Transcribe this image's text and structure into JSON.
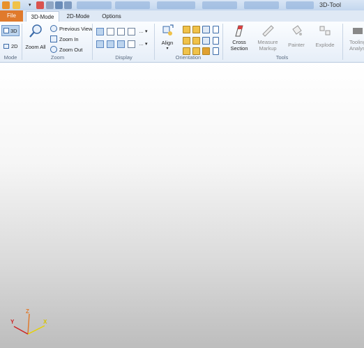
{
  "window": {
    "title": "3D-Tool"
  },
  "tabs": [
    {
      "label": "File"
    },
    {
      "label": "3D-Mode"
    },
    {
      "label": "2D-Mode"
    },
    {
      "label": "Options"
    }
  ],
  "ribbon": {
    "mode": {
      "label": "Mode",
      "btn3d": "3D",
      "btn2d": "2D"
    },
    "zoom": {
      "label": "Zoom",
      "zoom_all": "Zoom All",
      "previous_view": "Previous View",
      "zoom_in": "Zoom In",
      "zoom_out": "Zoom Out"
    },
    "display": {
      "label": "Display"
    },
    "orientation": {
      "label": "Orientation",
      "align": "Align"
    },
    "tools": {
      "label": "Tools",
      "cross_section_1": "Cross",
      "cross_section_2": "Section",
      "measure_1": "Measure",
      "measure_2": "Markup",
      "painter": "Painter",
      "explode": "Explode",
      "tooling_1": "Tooling",
      "tooling_2": "Analysis"
    }
  },
  "axes": {
    "x": "X",
    "y": "Y",
    "z": "Z"
  },
  "colors": {
    "file_tab": "#e07a2c",
    "axis_x": "#e6d200",
    "axis_y": "#cc2222",
    "axis_z": "#e07a2c"
  }
}
